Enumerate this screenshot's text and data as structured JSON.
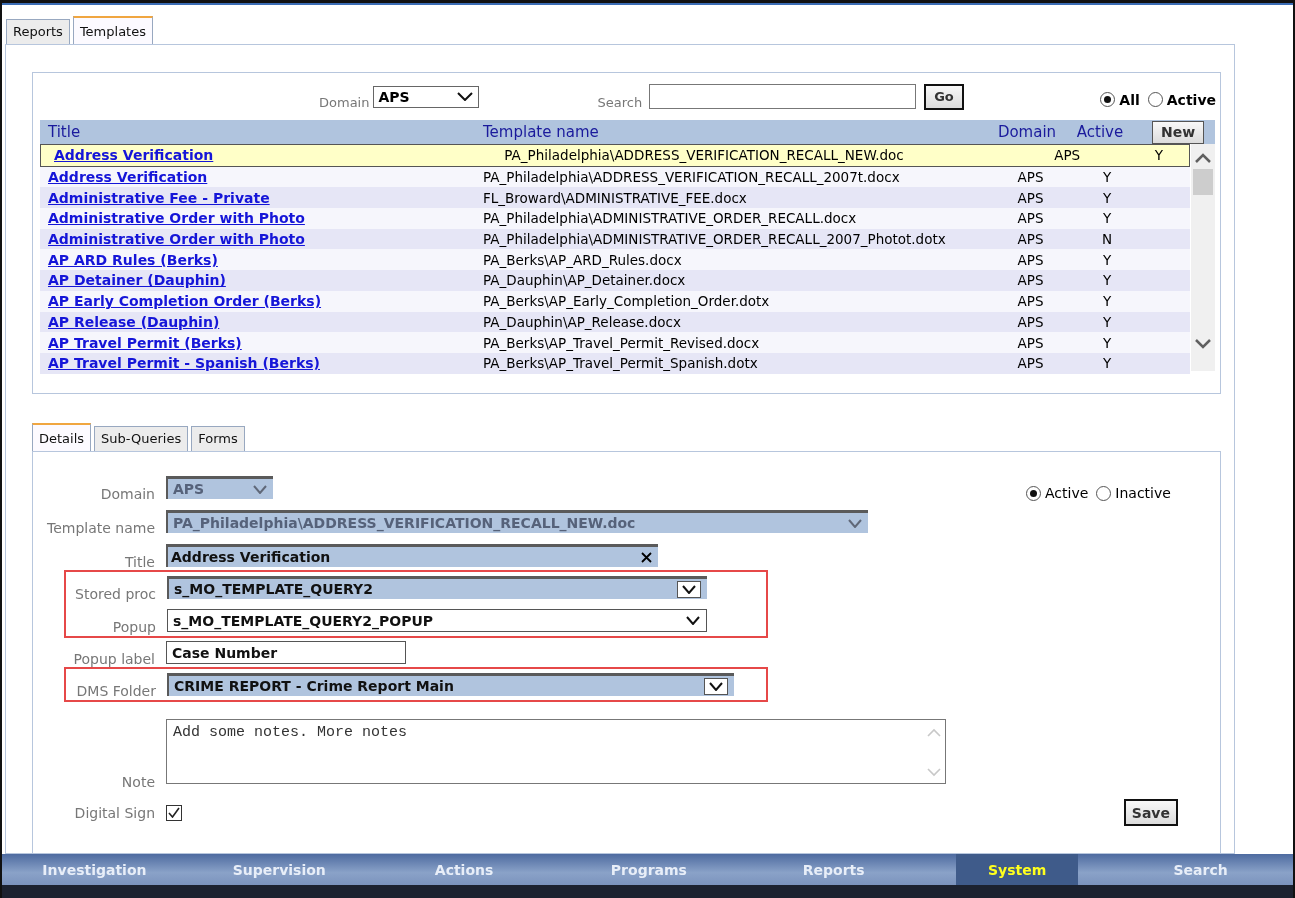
{
  "top_tabs": [
    {
      "label": "Reports",
      "selected": false
    },
    {
      "label": "Templates",
      "selected": true
    }
  ],
  "filter": {
    "domain_label": "Domain",
    "domain_value": "APS",
    "search_label": "Search",
    "go_button": "Go",
    "scope": [
      {
        "label": "All",
        "selected": true
      },
      {
        "label": "Active",
        "selected": false
      }
    ]
  },
  "table": {
    "columns": [
      "Title",
      "Template name",
      "Domain",
      "Active"
    ],
    "new_button": "New",
    "rows": [
      {
        "title": "Address Verification",
        "template": "PA_Philadelphia\\ADDRESS_VERIFICATION_RECALL_NEW.doc",
        "domain": "APS",
        "active": "Y",
        "selected": true
      },
      {
        "title": "Address Verification",
        "template": "PA_Philadelphia\\ADDRESS_VERIFICATION_RECALL_2007t.docx",
        "domain": "APS",
        "active": "Y",
        "selected": false
      },
      {
        "title": "Administrative Fee - Private",
        "template": "FL_Broward\\ADMINISTRATIVE_FEE.docx",
        "domain": "APS",
        "active": "Y",
        "selected": false
      },
      {
        "title": "Administrative Order with Photo",
        "template": "PA_Philadelphia\\ADMINISTRATIVE_ORDER_RECALL.docx",
        "domain": "APS",
        "active": "Y",
        "selected": false
      },
      {
        "title": "Administrative Order with Photo",
        "template": "PA_Philadelphia\\ADMINISTRATIVE_ORDER_RECALL_2007_Photot.dotx",
        "domain": "APS",
        "active": "N",
        "selected": false
      },
      {
        "title": "AP ARD Rules (Berks)",
        "template": "PA_Berks\\AP_ARD_Rules.docx",
        "domain": "APS",
        "active": "Y",
        "selected": false
      },
      {
        "title": "AP Detainer (Dauphin)",
        "template": "PA_Dauphin\\AP_Detainer.docx",
        "domain": "APS",
        "active": "Y",
        "selected": false
      },
      {
        "title": "AP Early Completion Order (Berks)",
        "template": "PA_Berks\\AP_Early_Completion_Order.dotx",
        "domain": "APS",
        "active": "Y",
        "selected": false
      },
      {
        "title": "AP Release (Dauphin)",
        "template": "PA_Dauphin\\AP_Release.docx",
        "domain": "APS",
        "active": "Y",
        "selected": false
      },
      {
        "title": "AP Travel Permit (Berks)",
        "template": "PA_Berks\\AP_Travel_Permit_Revised.docx",
        "domain": "APS",
        "active": "Y",
        "selected": false
      },
      {
        "title": "AP Travel Permit - Spanish (Berks)",
        "template": "PA_Berks\\AP_Travel_Permit_Spanish.dotx",
        "domain": "APS",
        "active": "Y",
        "selected": false
      }
    ]
  },
  "detail_tabs": [
    {
      "label": "Details",
      "selected": true
    },
    {
      "label": "Sub-Queries",
      "selected": false
    },
    {
      "label": "Forms",
      "selected": false
    }
  ],
  "details": {
    "status": [
      {
        "label": "Active",
        "selected": true
      },
      {
        "label": "Inactive",
        "selected": false
      }
    ],
    "groups": [
      {
        "outlined": false,
        "fields": [
          {
            "kind": "select",
            "label": "Domain",
            "value": "APS",
            "disabled": true,
            "highlighted": true
          },
          {
            "kind": "select",
            "label": "Template name",
            "value": "PA_Philadelphia\\ADDRESS_VERIFICATION_RECALL_NEW.doc",
            "disabled": true,
            "highlighted": true
          },
          {
            "kind": "clearable",
            "label": "Title",
            "value": "Address Verification",
            "disabled": false,
            "highlighted": true
          }
        ]
      },
      {
        "outlined": true,
        "fields": [
          {
            "kind": "select",
            "label": "Stored proc",
            "value": "s_MO_TEMPLATE_QUERY2",
            "disabled": false,
            "highlighted": true
          },
          {
            "kind": "select",
            "label": "Popup",
            "value": "s_MO_TEMPLATE_QUERY2_POPUP",
            "disabled": false,
            "highlighted": false
          }
        ]
      },
      {
        "outlined": false,
        "fields": [
          {
            "kind": "text",
            "label": "Popup label",
            "value": "Case Number",
            "disabled": false,
            "highlighted": false
          }
        ]
      },
      {
        "outlined": true,
        "fields": [
          {
            "kind": "select",
            "label": "DMS Folder",
            "value": "CRIME REPORT - Crime Report Main",
            "disabled": false,
            "highlighted": true
          }
        ]
      },
      {
        "outlined": false,
        "fields": [
          {
            "kind": "textarea",
            "label": "Note",
            "value": "Add some notes. More notes",
            "disabled": false,
            "highlighted": false
          }
        ]
      }
    ],
    "digital_sign": {
      "label": "Digital Sign",
      "checked": true
    },
    "save_button": "Save"
  },
  "nav": [
    {
      "label": "Investigation",
      "selected": false
    },
    {
      "label": "Supervision",
      "selected": false
    },
    {
      "label": "Actions",
      "selected": false
    },
    {
      "label": "Programs",
      "selected": false
    },
    {
      "label": "Reports",
      "selected": false
    },
    {
      "label": "System",
      "selected": true
    },
    {
      "label": "Search",
      "selected": false
    }
  ]
}
